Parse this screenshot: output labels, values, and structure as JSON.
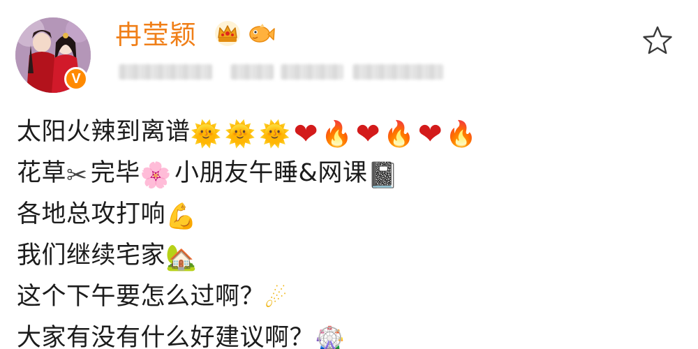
{
  "header": {
    "username": "冉莹颖",
    "badge_letter": "V"
  },
  "icons": {
    "crown": "crown-icon",
    "fish": "fish-icon",
    "star": "star-outline-icon",
    "verified": "verified-badge-icon"
  },
  "colors": {
    "username": "#f07f18",
    "badge": "#ff8a00",
    "text": "#1c1c1c"
  },
  "post": {
    "lines": [
      {
        "text": "太阳火辣到离谱",
        "emojis": [
          "🌞",
          "🌞",
          "🌞",
          "❤",
          "🔥",
          "❤",
          "🔥",
          "❤",
          "🔥"
        ]
      },
      {
        "text_a": "花草",
        "text_b": "完毕",
        "text_c": "小朋友午睡&网课",
        "emoji_a": "✂",
        "emoji_b": "🌸",
        "emoji_c": "📓"
      },
      {
        "text": "各地总攻打响",
        "emoji": "💪"
      },
      {
        "text": "我们继续宅家",
        "emoji": "🏡"
      },
      {
        "text": "这个下午要怎么过啊？",
        "emoji": "☄"
      },
      {
        "text": "大家有没有什么好建议啊？",
        "emoji": "🎡"
      }
    ]
  }
}
